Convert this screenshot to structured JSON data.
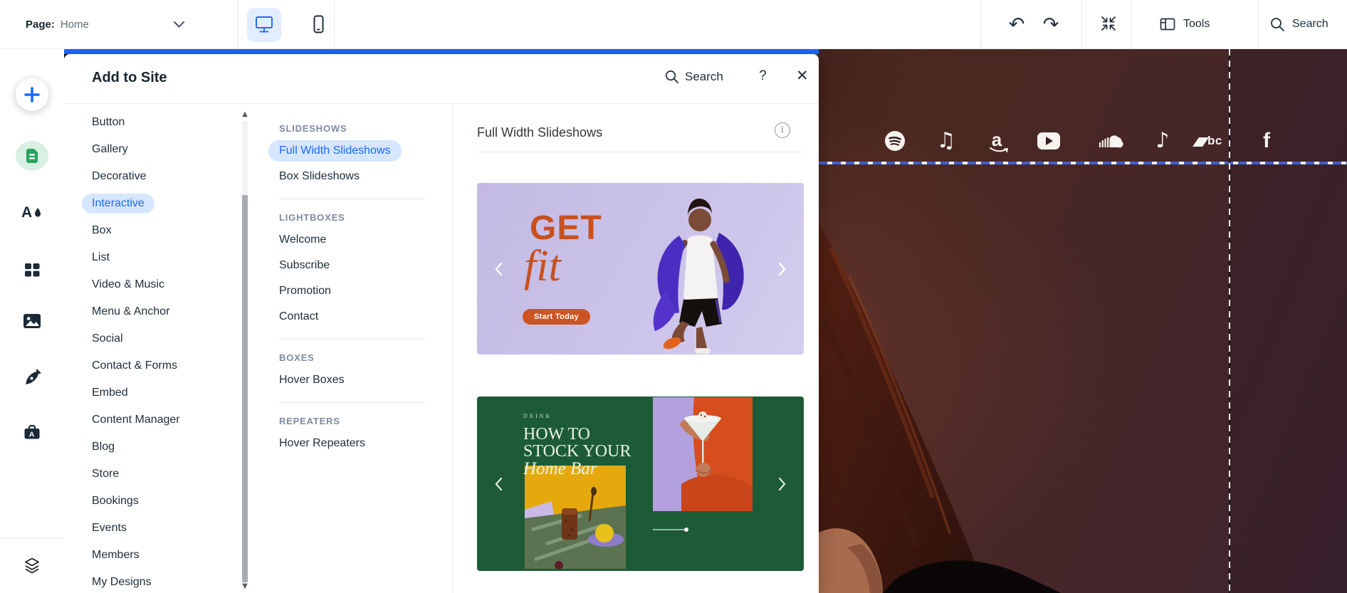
{
  "topbar": {
    "page_label": "Page:",
    "page_value": "Home",
    "tools_label": "Tools",
    "search_label": "Search"
  },
  "panel": {
    "title": "Add to Site",
    "search_label": "Search",
    "help_label": "?",
    "close_label": "✕",
    "categories": [
      "Button",
      "Gallery",
      "Decorative",
      "Interactive",
      "Box",
      "List",
      "Video & Music",
      "Menu & Anchor",
      "Social",
      "Contact & Forms",
      "Embed",
      "Content Manager",
      "Blog",
      "Store",
      "Bookings",
      "Events",
      "Members",
      "My Designs"
    ],
    "selected_category": "Interactive",
    "sections": [
      {
        "header": "SLIDESHOWS",
        "items": [
          "Full Width Slideshows",
          "Box Slideshows"
        ]
      },
      {
        "header": "LIGHTBOXES",
        "items": [
          "Welcome",
          "Subscribe",
          "Promotion",
          "Contact"
        ]
      },
      {
        "header": "BOXES",
        "items": [
          "Hover Boxes"
        ]
      },
      {
        "header": "REPEATERS",
        "items": [
          "Hover Repeaters"
        ]
      }
    ],
    "selected_item": "Full Width Slideshows",
    "content": {
      "title": "Full Width Slideshows",
      "info_label": "i",
      "slide1": {
        "headline": "GET",
        "subline": "fit",
        "button_label": "Start Today"
      },
      "slide2": {
        "eyebrow": "DRINK",
        "line1": "HOW TO",
        "line2": "STOCK YOUR",
        "line3": "Home Bar"
      }
    }
  },
  "canvas": {
    "social_icons": [
      "spotify",
      "apple-music",
      "amazon",
      "youtube",
      "soundcloud",
      "tiktok",
      "bandcamp",
      "facebook"
    ],
    "bandcamp_label": "bc",
    "amazon_label": "a",
    "facebook_label": "f",
    "colors": {
      "accent_blue": "#1a6aff",
      "selected_pill": "#d6e6ff",
      "canvas_brown": "#3f2519",
      "slide1_bg": "#cbc3e9",
      "slide1_accent": "#c7511f",
      "slide2_bg": "#1c5b35",
      "guide_blue": "#3f5fd0"
    }
  }
}
